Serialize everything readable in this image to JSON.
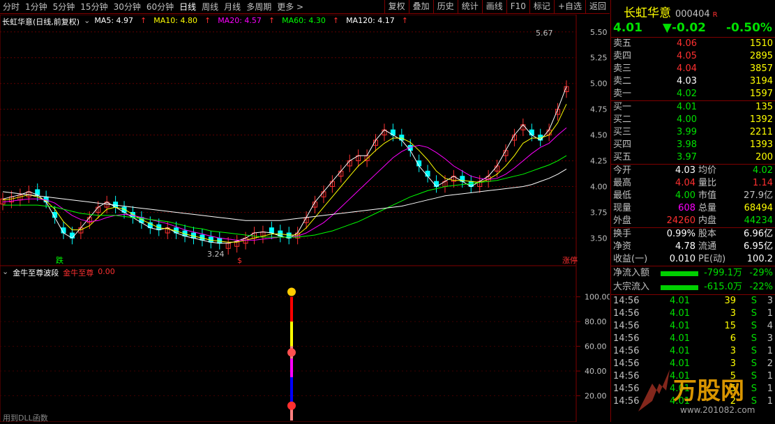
{
  "periods": [
    "分时",
    "1分钟",
    "5分钟",
    "15分钟",
    "30分钟",
    "60分钟",
    "日线",
    "周线",
    "月线",
    "多周期",
    "更多 >"
  ],
  "active_period": "日线",
  "toolbar": [
    "复权",
    "叠加",
    "历史",
    "统计",
    "画线",
    "F10",
    "标记",
    "+自选",
    "返回"
  ],
  "main_chart": {
    "title": "长虹华意(日线,前复权)",
    "ma": [
      {
        "label": "MA5: 4.97",
        "color": "#ffffff"
      },
      {
        "label": "MA10: 4.80",
        "color": "#ffff00"
      },
      {
        "label": "MA20: 4.57",
        "color": "#ff00ff"
      },
      {
        "label": "MA60: 4.30",
        "color": "#00ff00"
      },
      {
        "label": "MA120: 4.17",
        "color": "#ffffff"
      }
    ],
    "y_ticks": [
      "5.50",
      "5.25",
      "5.00",
      "4.75",
      "4.50",
      "4.25",
      "4.00",
      "3.75",
      "3.50"
    ],
    "high_label": "5.67",
    "low_label": "3.24",
    "tags": [
      "跌",
      "$",
      "涨停"
    ]
  },
  "chart_data": [
    {
      "type": "line",
      "title": "长虹华意(日线,前复权)",
      "ylim": [
        3.3,
        5.6
      ],
      "series": [
        {
          "name": "MA5",
          "color": "#ffffff",
          "values": [
            3.88,
            3.9,
            3.92,
            3.95,
            3.92,
            3.85,
            3.7,
            3.55,
            3.5,
            3.6,
            3.7,
            3.8,
            3.85,
            3.8,
            3.75,
            3.7,
            3.65,
            3.6,
            3.58,
            3.6,
            3.55,
            3.52,
            3.5,
            3.48,
            3.46,
            3.45,
            3.45,
            3.47,
            3.5,
            3.55,
            3.56,
            3.55,
            3.52,
            3.5,
            3.55,
            3.7,
            3.85,
            3.95,
            4.05,
            4.15,
            4.25,
            4.3,
            4.3,
            4.45,
            4.55,
            4.5,
            4.45,
            4.35,
            4.2,
            4.1,
            4.0,
            4.05,
            4.1,
            4.05,
            4.0,
            4.05,
            4.1,
            4.2,
            4.35,
            4.5,
            4.6,
            4.5,
            4.45,
            4.55,
            4.75,
            4.97
          ]
        },
        {
          "name": "MA10",
          "color": "#ffff00",
          "values": [
            3.87,
            3.88,
            3.9,
            3.92,
            3.9,
            3.86,
            3.78,
            3.66,
            3.58,
            3.58,
            3.62,
            3.7,
            3.78,
            3.8,
            3.78,
            3.73,
            3.68,
            3.64,
            3.6,
            3.59,
            3.57,
            3.54,
            3.52,
            3.5,
            3.48,
            3.47,
            3.46,
            3.46,
            3.48,
            3.5,
            3.52,
            3.54,
            3.54,
            3.53,
            3.53,
            3.6,
            3.7,
            3.8,
            3.9,
            4.0,
            4.1,
            4.2,
            4.27,
            4.35,
            4.42,
            4.47,
            4.47,
            4.43,
            4.35,
            4.26,
            4.15,
            4.08,
            4.06,
            4.06,
            4.05,
            4.04,
            4.07,
            4.12,
            4.2,
            4.3,
            4.42,
            4.47,
            4.47,
            4.5,
            4.62,
            4.8
          ]
        },
        {
          "name": "MA20",
          "color": "#ff00ff",
          "values": [
            3.85,
            3.86,
            3.87,
            3.88,
            3.88,
            3.87,
            3.84,
            3.78,
            3.72,
            3.68,
            3.66,
            3.67,
            3.7,
            3.72,
            3.73,
            3.72,
            3.7,
            3.68,
            3.66,
            3.64,
            3.61,
            3.58,
            3.56,
            3.54,
            3.52,
            3.5,
            3.49,
            3.48,
            3.48,
            3.48,
            3.49,
            3.5,
            3.51,
            3.51,
            3.52,
            3.55,
            3.6,
            3.65,
            3.72,
            3.8,
            3.88,
            3.96,
            4.04,
            4.12,
            4.2,
            4.28,
            4.34,
            4.38,
            4.4,
            4.38,
            4.33,
            4.27,
            4.2,
            4.15,
            4.1,
            4.08,
            4.07,
            4.08,
            4.12,
            4.18,
            4.25,
            4.32,
            4.38,
            4.42,
            4.5,
            4.57
          ]
        },
        {
          "name": "MA60",
          "color": "#00ff00",
          "values": [
            3.82,
            3.82,
            3.82,
            3.82,
            3.82,
            3.81,
            3.8,
            3.78,
            3.76,
            3.74,
            3.73,
            3.72,
            3.72,
            3.72,
            3.71,
            3.7,
            3.69,
            3.68,
            3.67,
            3.66,
            3.64,
            3.62,
            3.6,
            3.59,
            3.57,
            3.56,
            3.55,
            3.54,
            3.53,
            3.52,
            3.51,
            3.51,
            3.51,
            3.51,
            3.51,
            3.52,
            3.53,
            3.55,
            3.57,
            3.6,
            3.63,
            3.66,
            3.7,
            3.74,
            3.78,
            3.82,
            3.86,
            3.9,
            3.93,
            3.96,
            3.98,
            4.0,
            4.01,
            4.02,
            4.03,
            4.04,
            4.05,
            4.06,
            4.08,
            4.1,
            4.12,
            4.15,
            4.18,
            4.21,
            4.25,
            4.3
          ]
        },
        {
          "name": "MA120",
          "color": "#ffffff",
          "values": [
            3.95,
            3.94,
            3.93,
            3.92,
            3.91,
            3.9,
            3.89,
            3.88,
            3.87,
            3.86,
            3.85,
            3.84,
            3.83,
            3.82,
            3.81,
            3.8,
            3.79,
            3.78,
            3.77,
            3.76,
            3.75,
            3.74,
            3.73,
            3.72,
            3.71,
            3.7,
            3.69,
            3.68,
            3.67,
            3.67,
            3.67,
            3.67,
            3.67,
            3.68,
            3.69,
            3.7,
            3.71,
            3.72,
            3.73,
            3.74,
            3.75,
            3.76,
            3.77,
            3.78,
            3.79,
            3.8,
            3.81,
            3.83,
            3.85,
            3.87,
            3.89,
            3.91,
            3.92,
            3.93,
            3.94,
            3.95,
            3.96,
            3.97,
            3.98,
            3.99,
            4.0,
            4.02,
            4.05,
            4.08,
            4.12,
            4.17
          ]
        }
      ]
    },
    {
      "type": "bar",
      "title": "金牛至尊波段",
      "ylim": [
        0,
        115
      ],
      "values": [
        0,
        100
      ]
    }
  ],
  "indicator": {
    "title": "金牛至尊波段",
    "label": "金牛至尊",
    "value": "0.00",
    "y_ticks": [
      "100.00",
      "80.00",
      "60.00",
      "40.00",
      "20.00"
    ],
    "footer": "用到DLL函数"
  },
  "stock": {
    "name": "长虹华意",
    "code": "000404",
    "badge": "R",
    "price": "4.01",
    "change": "▼-0.02",
    "change_pct": "-0.50%"
  },
  "asks": [
    {
      "label": "卖五",
      "price": "4.06",
      "vol": "1510",
      "color": "#ff3030"
    },
    {
      "label": "卖四",
      "price": "4.05",
      "vol": "2895",
      "color": "#ff3030"
    },
    {
      "label": "卖三",
      "price": "4.04",
      "vol": "3857",
      "color": "#ff3030"
    },
    {
      "label": "卖二",
      "price": "4.03",
      "vol": "3194",
      "color": "#ffffff"
    },
    {
      "label": "卖一",
      "price": "4.02",
      "vol": "1597",
      "color": "#00e000"
    }
  ],
  "bids": [
    {
      "label": "买一",
      "price": "4.01",
      "vol": "135",
      "color": "#00e000"
    },
    {
      "label": "买二",
      "price": "4.00",
      "vol": "1392",
      "color": "#00e000"
    },
    {
      "label": "买三",
      "price": "3.99",
      "vol": "2211",
      "color": "#00e000"
    },
    {
      "label": "买四",
      "price": "3.98",
      "vol": "1393",
      "color": "#00e000"
    },
    {
      "label": "买五",
      "price": "3.97",
      "vol": "200",
      "color": "#00e000"
    }
  ],
  "stats1": [
    {
      "a": "今开",
      "b": "4.03",
      "bc": "#ffffff",
      "c": "均价",
      "d": "4.02",
      "dc": "#00e000"
    },
    {
      "a": "最高",
      "b": "4.04",
      "bc": "#ff3030",
      "c": "量比",
      "d": "1.14",
      "dc": "#ff3030"
    },
    {
      "a": "最低",
      "b": "4.00",
      "bc": "#00e000",
      "c": "市值",
      "d": "27.9亿",
      "dc": "#c0c0c0"
    },
    {
      "a": "现量",
      "b": "608",
      "bc": "#ff00ff",
      "c": "总量",
      "d": "68494",
      "dc": "#ffff00"
    },
    {
      "a": "外盘",
      "b": "24260",
      "bc": "#ff3030",
      "c": "内盘",
      "d": "44234",
      "dc": "#00e000"
    }
  ],
  "stats2": [
    {
      "a": "换手",
      "b": "0.99%",
      "c": "股本",
      "d": "6.96亿"
    },
    {
      "a": "净资",
      "b": "4.78",
      "c": "流通",
      "d": "6.95亿"
    },
    {
      "a": "收益(一)",
      "b": "0.010",
      "c": "PE(动)",
      "d": "100.2"
    }
  ],
  "flows": [
    {
      "name": "净流入额",
      "val": "-799.1万",
      "pct": "-29%"
    },
    {
      "name": "大宗流入",
      "val": "-615.0万",
      "pct": "-22%"
    }
  ],
  "ticks": [
    {
      "t": "14:56",
      "p": "4.01",
      "v": "39",
      "s": "S",
      "n": "3"
    },
    {
      "t": "14:56",
      "p": "4.01",
      "v": "3",
      "s": "S",
      "n": "1"
    },
    {
      "t": "14:56",
      "p": "4.01",
      "v": "15",
      "s": "S",
      "n": "4"
    },
    {
      "t": "14:56",
      "p": "4.01",
      "v": "6",
      "s": "S",
      "n": "3"
    },
    {
      "t": "14:56",
      "p": "4.01",
      "v": "3",
      "s": "S",
      "n": "1"
    },
    {
      "t": "14:56",
      "p": "4.01",
      "v": "3",
      "s": "S",
      "n": "2"
    },
    {
      "t": "14:56",
      "p": "4.01",
      "v": "5",
      "s": "S",
      "n": "1"
    },
    {
      "t": "14:56",
      "p": "4.01",
      "v": "5",
      "s": "S",
      "n": "1"
    },
    {
      "t": "14:56",
      "p": "4.01",
      "v": "2",
      "s": "S",
      "n": "1"
    }
  ]
}
